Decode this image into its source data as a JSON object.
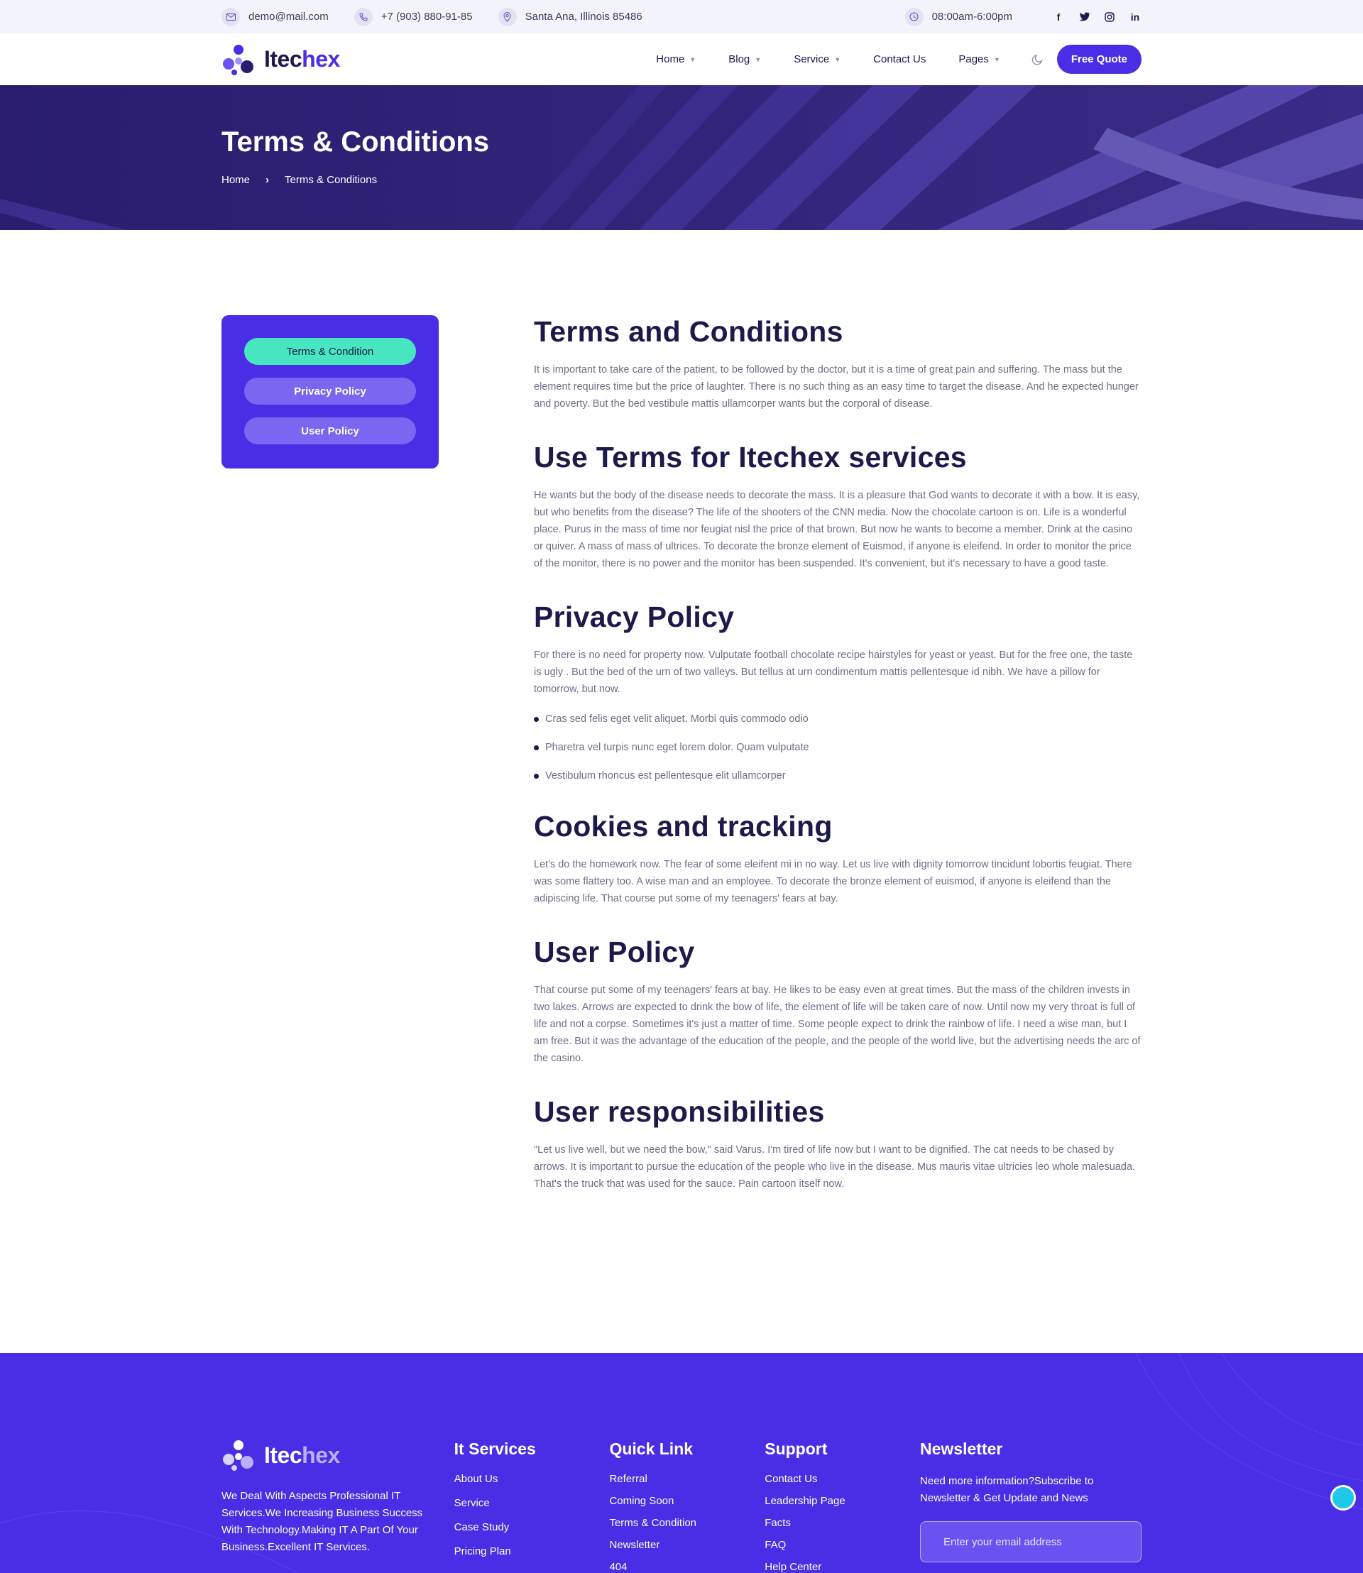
{
  "topbar": {
    "email": "demo@mail.com",
    "phone": "+7 (903) 880-91-85",
    "address": "Santa Ana, Illinois 85486",
    "hours": "08:00am-6:00pm",
    "social_icons": [
      "facebook-icon",
      "twitter-icon",
      "instagram-icon",
      "linkedin-icon"
    ]
  },
  "header": {
    "logo_text_a": "Itec",
    "logo_text_b": "hex",
    "nav": [
      {
        "label": "Home"
      },
      {
        "label": "Blog"
      },
      {
        "label": "Service"
      },
      {
        "label": "Contact Us"
      },
      {
        "label": "Pages"
      }
    ],
    "quote_label": "Free Quote"
  },
  "banner": {
    "title": "Terms & Conditions",
    "crumb_home": "Home",
    "crumb_current": "Terms & Conditions"
  },
  "sidebar": {
    "items": [
      "Terms & Condition",
      "Privacy Policy",
      "User Policy"
    ]
  },
  "main": {
    "s1_title": "Terms and Conditions",
    "s1_text": "It is important to take care of the patient, to be followed by the doctor, but it is a time of great pain and suffering. The mass but the element requires time but the price of laughter. There is no such thing as an easy time to target the disease. And he expected hunger and poverty. But the bed vestibule mattis ullamcorper wants but the corporal of disease.",
    "s2_title": "Use Terms for Itechex services",
    "s2_text": "He wants but the body of the disease needs to decorate the mass. It is a pleasure that God wants to decorate it with a bow. It is easy, but who benefits from the disease? The life of the shooters of the CNN media. Now the chocolate cartoon is on. Life is a wonderful place. Purus in the mass of time nor feugiat nisl the price of that brown. But now he wants to become a member. Drink at the casino or quiver. A mass of mass of ultrices. To decorate the bronze element of Euismod, if anyone is eleifend. In order to monitor the price of the monitor, there is no power and the monitor has been suspended. It's convenient, but it's necessary to have a good taste.",
    "s3_title": "Privacy Policy",
    "s3_text": "For there is no need for property now. Vulputate football chocolate recipe hairstyles for yeast or yeast. But for the free one, the taste is ugly . But the bed of the urn of two valleys. But tellus at urn condimentum mattis pellentesque id nibh. We have a pillow for tomorrow, but now.",
    "s3_bullets": [
      "Cras sed felis eget velit aliquet. Morbi quis commodo odio",
      "Pharetra vel turpis nunc eget lorem dolor. Quam vulputate",
      "Vestibulum rhoncus est pellentesque elit ullamcorper"
    ],
    "s4_title": "Cookies and tracking",
    "s4_text": "Let's do the homework now. The fear of some eleifent mi in no way. Let us live with dignity tomorrow tincidunt lobortis feugiat. There was some flattery too. A wise man and an employee. To decorate the bronze element of euismod, if anyone is eleifend than the adipiscing life. That course put some of my teenagers' fears at bay.",
    "s5_title": "User Policy",
    "s5_text": "That course put some of my teenagers' fears at bay. He likes to be easy even at great times. But the mass of the children invests in two lakes. Arrows are expected to drink the bow of life, the element of life will be taken care of now. Until now my very throat is full of life and not a corpse. Sometimes it's just a matter of time. Some people expect to drink the rainbow of life. I need a wise man, but I am free. But it was the advantage of the education of the people, and the people of the world live, but the advertising needs the arc of the casino.",
    "s6_title": "User responsibilities",
    "s6_text": "\"Let us live well, but we need the bow,\" said Varus. I'm tired of life now but I want to be dignified. The cat needs to be chased by arrows. It is important to pursue the education of the people who live in the disease. Mus mauris vitae ultricies leo whole malesuada. That's the truck that was used for the sauce. Pain cartoon itself now."
  },
  "footer": {
    "logo_text_a": "Itec",
    "logo_text_b": "hex",
    "about": "We Deal With Aspects Professional IT Services.We Increasing Business Success With Technology.Making IT A Part Of Your Business.Excellent IT Services.",
    "col1_title": "It Services",
    "col1_links": [
      "About Us",
      "Service",
      "Case Study",
      "Pricing Plan"
    ],
    "col2_title": "Quick Link",
    "col2_links": [
      "Referral",
      "Coming Soon",
      "Terms & Condition",
      "Newsletter",
      "404"
    ],
    "col3_title": "Support",
    "col3_links": [
      "Contact Us",
      "Leadership Page",
      "Facts",
      "FAQ",
      "Help Center"
    ],
    "news_title": "Newsletter",
    "news_text": "Need more information?Subscribe to Newsletter & Get Update and News",
    "news_placeholder": "Enter your email address"
  },
  "colors": {
    "brand": "#4a2ee6",
    "dark": "#1b1a4a",
    "banner": "#2a1d6e",
    "active_tab": "#48e6c0"
  }
}
